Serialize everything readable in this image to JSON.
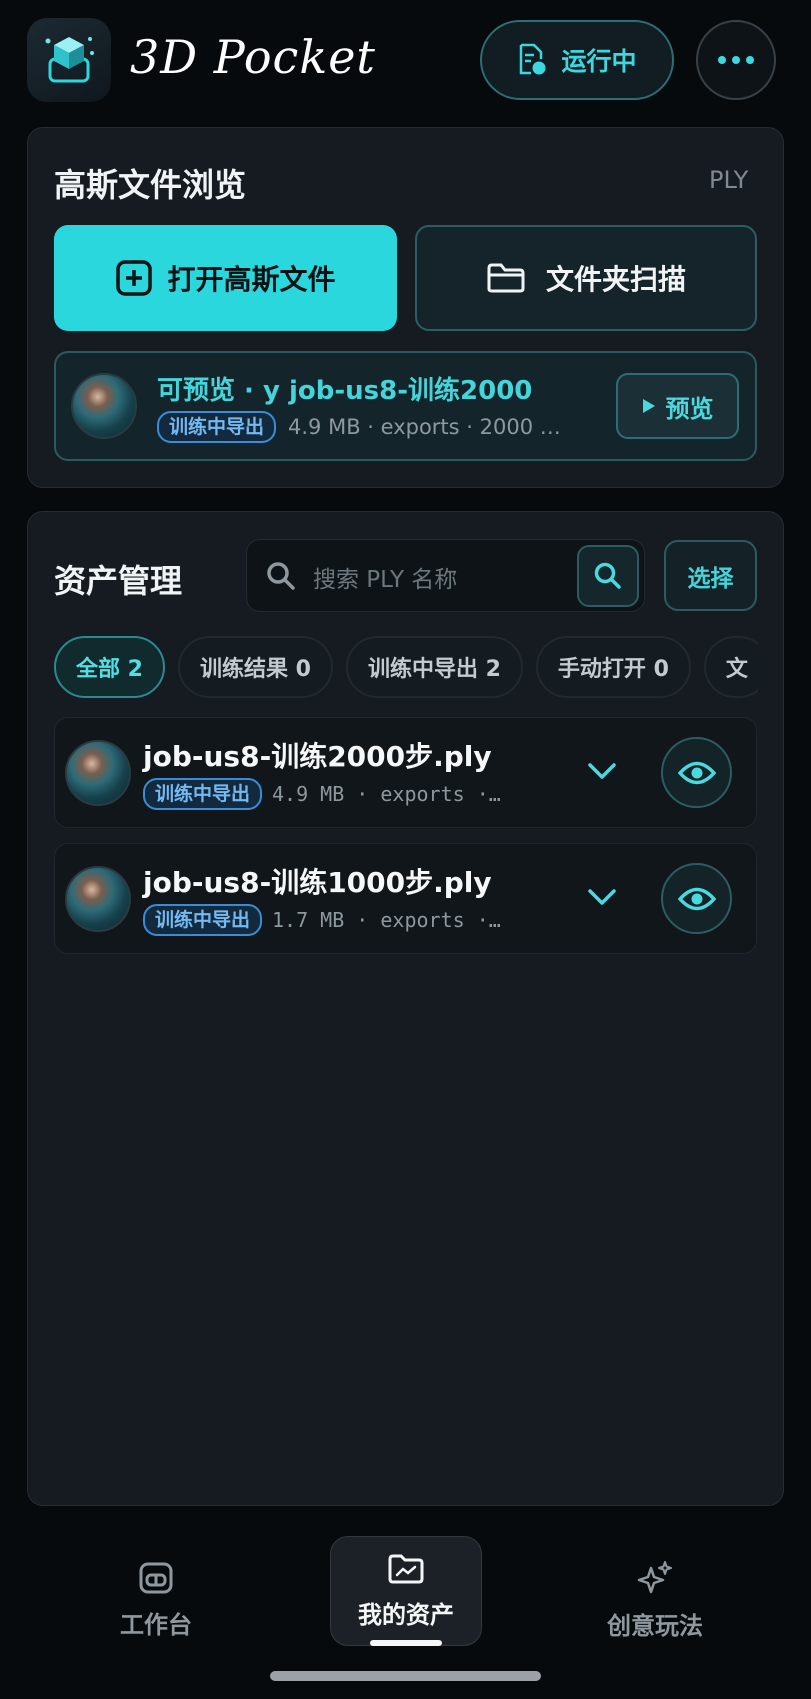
{
  "header": {
    "app_title": "3D Pocket",
    "status_label": "运行中",
    "logo_icon": "cube-logo-icon",
    "more_icon": "more-dots-icon"
  },
  "gaussian_browse": {
    "title": "高斯文件浏览",
    "format_label": "PLY",
    "open_button_label": "打开高斯文件",
    "scan_button_label": "文件夹扫描",
    "preview_item": {
      "title": "可预览 · y      job-us8-训练2000",
      "badge": "训练中导出",
      "meta": "4.9 MB · exports · 2000 …",
      "preview_button_label": "预览"
    }
  },
  "asset_manager": {
    "title": "资产管理",
    "search_placeholder": "搜索 PLY 名称",
    "select_button_label": "选择",
    "filters": [
      {
        "label": "全部 2",
        "active": true
      },
      {
        "label": "训练结果 0",
        "active": false
      },
      {
        "label": "训练中导出 2",
        "active": false
      },
      {
        "label": "手动打开 0",
        "active": false
      },
      {
        "label": "文",
        "active": false
      }
    ],
    "items": [
      {
        "name": "job-us8-训练2000步.ply",
        "badge": "训练中导出",
        "meta": "4.9 MB · exports ·…"
      },
      {
        "name": "job-us8-训练1000步.ply",
        "badge": "训练中导出",
        "meta": "1.7 MB · exports ·…"
      }
    ]
  },
  "bottom_nav": {
    "items": [
      {
        "label": "工作台",
        "icon": "workbench-icon",
        "active": false
      },
      {
        "label": "我的资产",
        "icon": "assets-folder-icon",
        "active": true
      },
      {
        "label": "创意玩法",
        "icon": "sparkles-icon",
        "active": false
      }
    ]
  },
  "colors": {
    "accent": "#2ad7dc",
    "background": "#070a0d",
    "card": "#151b20",
    "badge_blue": "#3b8cd6"
  }
}
